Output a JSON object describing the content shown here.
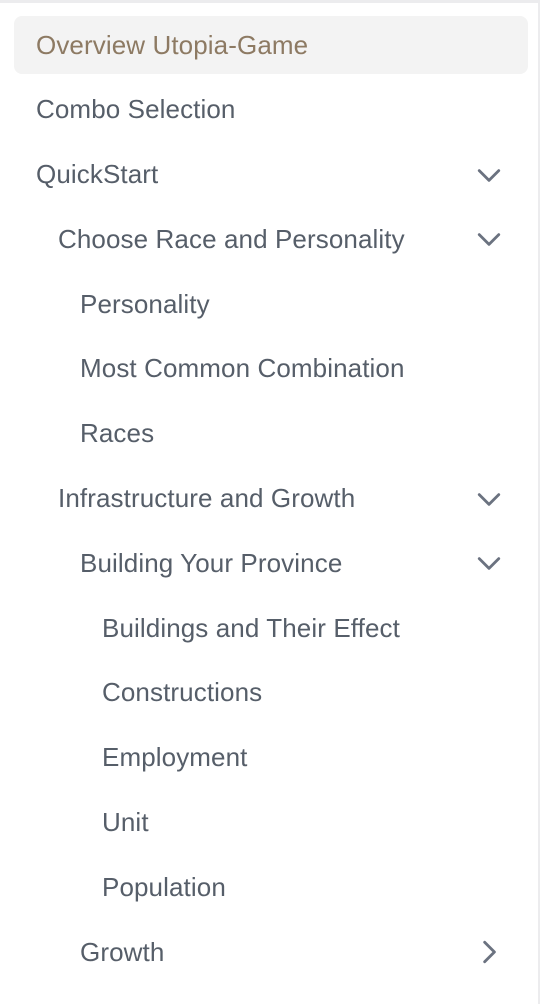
{
  "nav": {
    "items": [
      {
        "label": "Overview Utopia-Game",
        "level": 0,
        "active": true,
        "toggle": null
      },
      {
        "label": "Combo Selection",
        "level": 0,
        "active": false,
        "toggle": null
      },
      {
        "label": "QuickStart",
        "level": 0,
        "active": false,
        "toggle": "expanded"
      },
      {
        "label": "Choose Race and Personality",
        "level": 1,
        "active": false,
        "toggle": "expanded"
      },
      {
        "label": "Personality",
        "level": 2,
        "active": false,
        "toggle": null
      },
      {
        "label": "Most Common Combination",
        "level": 2,
        "active": false,
        "toggle": null
      },
      {
        "label": "Races",
        "level": 2,
        "active": false,
        "toggle": null
      },
      {
        "label": "Infrastructure and Growth",
        "level": 1,
        "active": false,
        "toggle": "expanded"
      },
      {
        "label": "Building Your Province",
        "level": 2,
        "active": false,
        "toggle": "expanded"
      },
      {
        "label": "Buildings and Their Effect",
        "level": 3,
        "active": false,
        "toggle": null
      },
      {
        "label": "Constructions",
        "level": 3,
        "active": false,
        "toggle": null
      },
      {
        "label": "Employment",
        "level": 3,
        "active": false,
        "toggle": null
      },
      {
        "label": "Unit",
        "level": 3,
        "active": false,
        "toggle": null
      },
      {
        "label": "Population",
        "level": 3,
        "active": false,
        "toggle": null
      },
      {
        "label": "Growth",
        "level": 2,
        "active": false,
        "toggle": "collapsed"
      }
    ]
  },
  "icons": {
    "expanded": "chevron-down-icon",
    "collapsed": "chevron-right-icon"
  },
  "colors": {
    "active_text": "#8d7a63",
    "active_bg": "#f3f3f3",
    "text": "#565e69",
    "chevron": "#6b7280"
  }
}
